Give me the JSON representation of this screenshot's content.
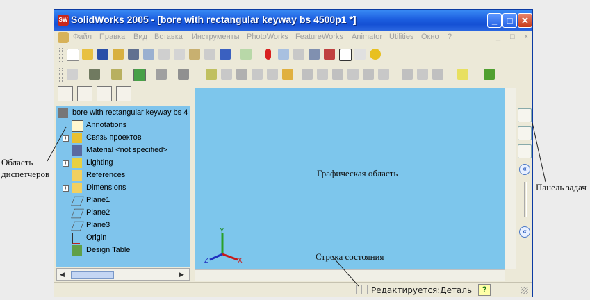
{
  "window": {
    "title": "SolidWorks 2005 - [bore with rectangular keyway bs 4500p1 *]",
    "logo_text": "SW",
    "controls": [
      "_",
      "□",
      "✕"
    ]
  },
  "menu": {
    "items": [
      "Файл",
      "Правка",
      "Вид",
      "Вставка",
      "Инструменты",
      "PhotoWorks",
      "FeatureWorks",
      "Animator",
      "Utilities",
      "Окно",
      "?"
    ],
    "doc_controls": [
      "_",
      "□",
      "×"
    ]
  },
  "feature_tree": {
    "root": "bore with rectangular keyway bs 4",
    "items": [
      {
        "label": "Annotations",
        "icon": "annotations-icon",
        "expandable": false
      },
      {
        "label": "Связь проектов",
        "icon": "design-binder-icon",
        "expandable": true
      },
      {
        "label": "Material <not specified>",
        "icon": "material-icon",
        "expandable": false
      },
      {
        "label": "Lighting",
        "icon": "lighting-icon",
        "expandable": true
      },
      {
        "label": "References",
        "icon": "folder-icon",
        "expandable": false
      },
      {
        "label": "Dimensions",
        "icon": "folder-icon",
        "expandable": true
      },
      {
        "label": "Plane1",
        "icon": "plane-icon",
        "expandable": false
      },
      {
        "label": "Plane2",
        "icon": "plane-icon",
        "expandable": false
      },
      {
        "label": "Plane3",
        "icon": "plane-icon",
        "expandable": false
      },
      {
        "label": "Origin",
        "icon": "origin-icon",
        "expandable": false
      },
      {
        "label": "Design Table",
        "icon": "design-table-icon",
        "expandable": false
      }
    ]
  },
  "callouts": {
    "manager_area_line1": "Область",
    "manager_area_line2": "диспетчеров",
    "task_pane": "Панель задач",
    "graphics_area": "Графическая область",
    "status_bar": "Строка состояния"
  },
  "triad": {
    "x": "X",
    "y": "Y",
    "z": "Z"
  },
  "status": {
    "text": "Редактируется:Деталь",
    "help": "?"
  },
  "taskpane": {
    "collapse1": "«",
    "collapse2": "«"
  },
  "colors": {
    "graphics_bg": "#7dc6ec",
    "titlebar": "#1d5fe0",
    "tree_bg": "#7fc4ec"
  }
}
